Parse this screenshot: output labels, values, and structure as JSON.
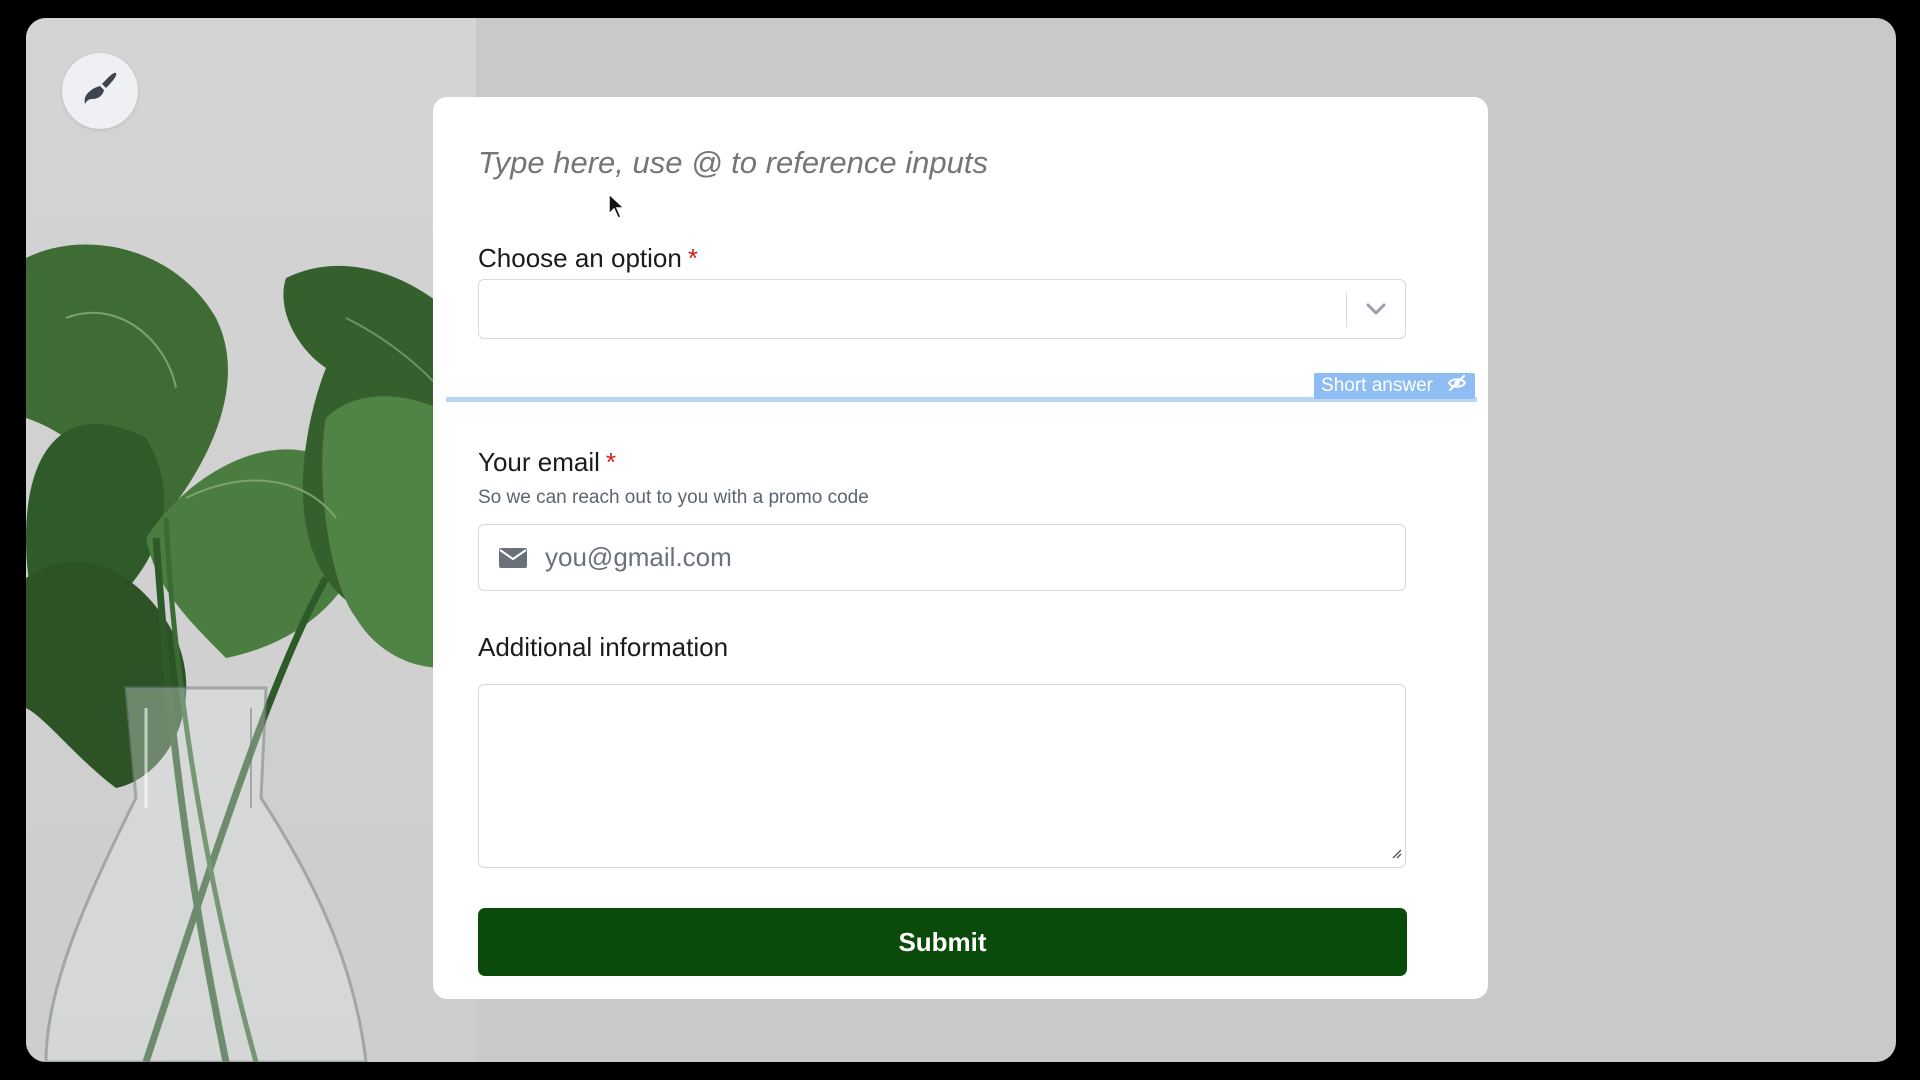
{
  "form": {
    "heading_placeholder": "Type here, use @ to reference inputs",
    "choose_label": "Choose an option",
    "required_mark": "*",
    "badge_label": "Short answer",
    "email_label": "Your email",
    "email_help": "So we can reach out to you with a promo code",
    "email_placeholder": "you@gmail.com",
    "additional_label": "Additional information",
    "submit_label": "Submit"
  },
  "icons": {
    "theme": "paintbrush-icon",
    "select": "chevron-down-icon",
    "badge": "eye-slash-icon",
    "email": "envelope-icon"
  },
  "colors": {
    "submit": "#0a4a0a",
    "required": "#d21c1c",
    "badge": "#8dbdf2",
    "divider": "#b9d6f6"
  }
}
